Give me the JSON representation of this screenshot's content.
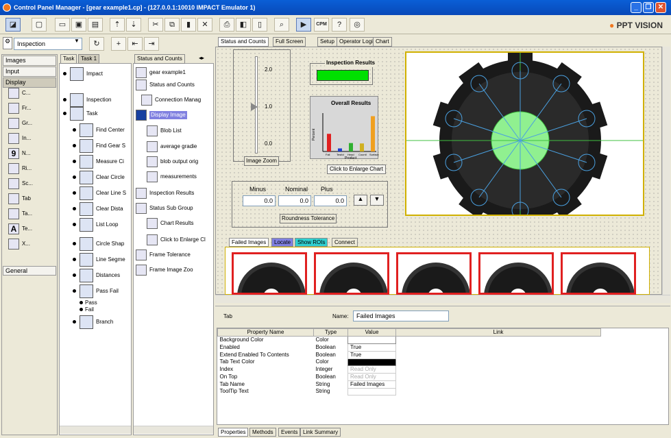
{
  "window": {
    "title": "Control Panel Manager - [gear example1.cp] - (127.0.0.1:10010 IMPACT Emulator 1)",
    "min": "_",
    "max": "❐",
    "close": "✕"
  },
  "brand": {
    "name": "PPT VISION"
  },
  "left_toolbar": {
    "mode": "Inspection"
  },
  "categories": [
    {
      "label": "Images"
    },
    {
      "label": "Input"
    },
    {
      "label": "Display"
    }
  ],
  "category_general": "General",
  "palette": [
    {
      "label": "C...",
      "icon": "chart-icon"
    },
    {
      "label": "Fr...",
      "icon": "frame-icon"
    },
    {
      "label": "Gr...",
      "icon": "graphic-icon"
    },
    {
      "label": "In...",
      "icon": "indicator-icon"
    },
    {
      "label": "N...",
      "icon": "numeric-icon",
      "glyph": "9"
    },
    {
      "label": "Ri...",
      "icon": "rich-text-icon"
    },
    {
      "label": "Sc...",
      "icon": "scroll-icon"
    },
    {
      "label": "Tab",
      "icon": "tab-icon"
    },
    {
      "label": "Ta...",
      "icon": "table-icon"
    },
    {
      "label": "Te...",
      "icon": "text-icon",
      "glyph": "A"
    },
    {
      "label": "X...",
      "icon": "xy-chart-icon"
    }
  ],
  "task_panel": {
    "tabs": [
      {
        "label": "Task"
      },
      {
        "label": "Task 1"
      }
    ],
    "items": [
      {
        "label": "Impact"
      },
      {
        "label": "Inspection"
      },
      {
        "label": "Task"
      },
      {
        "label": "Find Center"
      },
      {
        "label": "Find Gear S"
      },
      {
        "label": "Measure Ci"
      },
      {
        "label": "Clear Circle"
      },
      {
        "label": "Clear Line S"
      },
      {
        "label": "Clear Dista"
      },
      {
        "label": "List Loop"
      },
      {
        "label": "Circle Shap"
      },
      {
        "label": "Line Segme"
      },
      {
        "label": "Distances"
      },
      {
        "label": "Pass Fail"
      },
      {
        "label": "Pass"
      },
      {
        "label": "Fail"
      },
      {
        "label": "Branch"
      }
    ]
  },
  "status_panel": {
    "header": "Status and Counts",
    "items": [
      {
        "label": "gear example1"
      },
      {
        "label": "Status and Counts"
      },
      {
        "label": "Connection Manag"
      },
      {
        "label": "Display Image"
      },
      {
        "label": "Blob List"
      },
      {
        "label": "average gradie"
      },
      {
        "label": "blob output orig"
      },
      {
        "label": "measurements"
      },
      {
        "label": "Inspection Results"
      },
      {
        "label": "Status Sub Group"
      },
      {
        "label": "Chart Results"
      },
      {
        "label": "Click to Enlarge Cl"
      },
      {
        "label": "Frame Tolerance"
      },
      {
        "label": "Frame Image Zoo"
      }
    ]
  },
  "main_tabs": [
    {
      "label": "Status and Counts"
    },
    {
      "label": "Full Screen"
    },
    {
      "label": "Setup"
    },
    {
      "label": "Operator Login"
    },
    {
      "label": "Chart"
    }
  ],
  "zoom": {
    "frame_label": "Image Zoom",
    "ticks": [
      "2.0",
      "1.0",
      "0.0"
    ]
  },
  "inspection_results": {
    "label": "Inspection Results"
  },
  "overall_results": {
    "title": "Overall Results",
    "xlabel": "Product",
    "ylabel": "Percent",
    "button": "Click to Enlarge Chart"
  },
  "chart_data": {
    "type": "bar",
    "title": "Overall Results",
    "xlabel": "Product",
    "ylabel": "Percent",
    "ylim": [
      0,
      100
    ],
    "categories": [
      "Fail",
      "TestId",
      "Head",
      "CountI",
      "Surface"
    ],
    "values": [
      46,
      8,
      22,
      21,
      92
    ],
    "colors": [
      "#e02020",
      "#2040d0",
      "#30b030",
      "#d0b020",
      "#f0a020"
    ]
  },
  "tolerance": {
    "labels": [
      "Minus",
      "Nominal",
      "Plus"
    ],
    "values": [
      "0.0",
      "0.0",
      "0.0"
    ],
    "frame_label": "Roundness Tolerance"
  },
  "image_tabs": [
    {
      "label": "Failed Images"
    },
    {
      "label": "Locate"
    },
    {
      "label": "Show ROIs"
    },
    {
      "label": "Connect"
    }
  ],
  "props": {
    "header_left": "Tab",
    "name_label": "Name:",
    "name_value": "Failed Images",
    "columns": [
      "Property Name",
      "Type",
      "Value",
      "Link"
    ],
    "rows": [
      {
        "name": "Background Color",
        "type": "Color",
        "value": ""
      },
      {
        "name": "Enabled",
        "type": "Boolean",
        "value": "True"
      },
      {
        "name": "Extend Enabled To Contents",
        "type": "Boolean",
        "value": "True"
      },
      {
        "name": "Tab Text Color",
        "type": "Color",
        "value": ""
      },
      {
        "name": "Index",
        "type": "Integer",
        "value": "Read Only"
      },
      {
        "name": "On Top",
        "type": "Boolean",
        "value": "Read Only"
      },
      {
        "name": "Tab Name",
        "type": "String",
        "value": "Failed Images"
      },
      {
        "name": "ToolTip Text",
        "type": "String",
        "value": ""
      }
    ],
    "bottom_tabs": [
      {
        "label": "Properties"
      },
      {
        "label": "Methods"
      },
      {
        "label": "Events"
      },
      {
        "label": "Link Summary"
      }
    ]
  }
}
